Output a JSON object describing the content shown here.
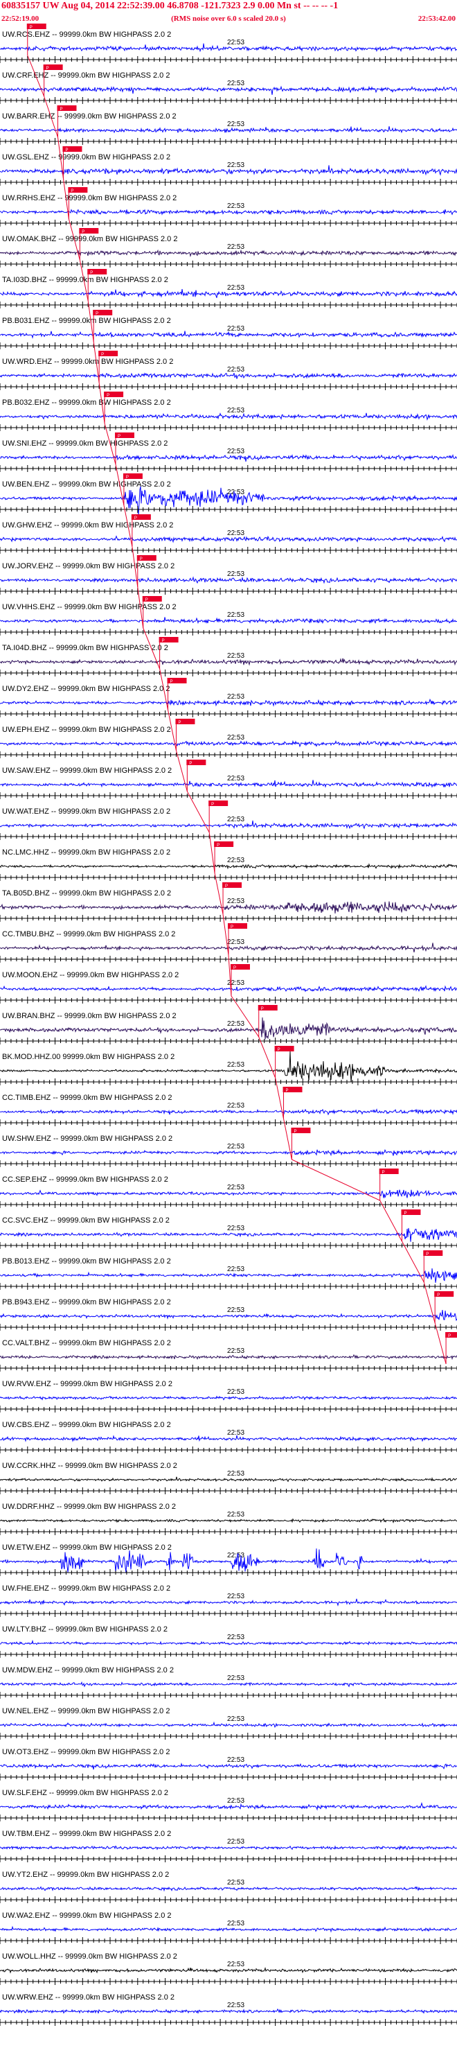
{
  "header": {
    "title": "60835157 UW Aug 04, 2014 22:52:39.00    46.8708 -121.7323  2.9 0.00 Mn st -- -- -- -1",
    "subtitle": "(RMS noise over 6.0 s scaled 20.0 s)",
    "start_time": "22:52:19.00",
    "end_time": "22:53:42.00"
  },
  "chart_data": {
    "type": "line",
    "title": "60835157 UW Aug 04, 2014 22:52:39.00    46.8708 -121.7323  2.9 0.00 Mn st -- -- -- -1",
    "xlabel": "",
    "ylabel": "",
    "x_start": "22:52:19.00",
    "x_end": "22:53:42.00",
    "x_range_s": [
      0,
      83
    ],
    "minute_tick_label": "22:53",
    "minute_tick_s": 41,
    "pick_label": "P",
    "colors": {
      "blue": "#0000ff",
      "black": "#000000",
      "purple": "#2b0d5a",
      "pick": "#e8002a"
    },
    "series": [
      {
        "label": "UW.RCS.EHZ -- 99999.0km BW  HIGHPASS  2.0  2",
        "color": "blue",
        "amp": 0.45,
        "pick_s": 5.0,
        "bursts": []
      },
      {
        "label": "UW.CRF.EHZ -- 99999.0km BW  HIGHPASS  2.0  2",
        "color": "blue",
        "amp": 0.45,
        "pick_s": 8.0,
        "bursts": []
      },
      {
        "label": "UW.BARR.EHZ -- 99999.0km BW  HIGHPASS  2.0  2",
        "color": "blue",
        "amp": 0.4,
        "pick_s": 10.5,
        "bursts": []
      },
      {
        "label": "UW.GSL.EHZ -- 99999.0km BW  HIGHPASS  2.0  2",
        "color": "blue",
        "amp": 0.55,
        "pick_s": 11.5,
        "bursts": []
      },
      {
        "label": "UW.RRHS.EHZ -- 99999.0km BW  HIGHPASS  2.0  2",
        "color": "blue",
        "amp": 0.45,
        "pick_s": 12.5,
        "bursts": []
      },
      {
        "label": "UW.OMAK.BHZ -- 99999.0km BW  HIGHPASS  2.0  2",
        "color": "purple",
        "amp": 0.45,
        "pick_s": 14.5,
        "bursts": []
      },
      {
        "label": "TA.I03D.BHZ -- 99999.0km BW  HIGHPASS  2.0  2",
        "color": "blue",
        "amp": 0.5,
        "pick_s": 16.0,
        "bursts": []
      },
      {
        "label": "PB.B031.EHZ -- 99999.0km BW  HIGHPASS  2.0  2",
        "color": "blue",
        "amp": 0.45,
        "pick_s": 17.0,
        "bursts": []
      },
      {
        "label": "UW.WRD.EHZ -- 99999.0km BW  HIGHPASS  2.0  2",
        "color": "blue",
        "amp": 0.45,
        "pick_s": 18.0,
        "bursts": []
      },
      {
        "label": "PB.B032.EHZ -- 99999.0km BW  HIGHPASS  2.0  2",
        "color": "blue",
        "amp": 0.45,
        "pick_s": 19.0,
        "bursts": []
      },
      {
        "label": "UW.SNI.EHZ -- 99999.0km BW  HIGHPASS  2.0  2",
        "color": "blue",
        "amp": 0.45,
        "pick_s": 21.0,
        "bursts": []
      },
      {
        "label": "UW.BEN.EHZ -- 99999.0km BW  HIGHPASS  2.0  2",
        "color": "blue",
        "amp": 0.45,
        "pick_s": 22.5,
        "bursts": [
          [
            22.5,
            48.0,
            2.2
          ]
        ]
      },
      {
        "label": "UW.GHW.EHZ -- 99999.0km BW  HIGHPASS  2.0  2",
        "color": "blue",
        "amp": 0.45,
        "pick_s": 24.0,
        "bursts": []
      },
      {
        "label": "UW.JORV.EHZ -- 99999.0km BW  HIGHPASS  2.0  2",
        "color": "blue",
        "amp": 0.45,
        "pick_s": 25.0,
        "bursts": []
      },
      {
        "label": "UW.VHHS.EHZ -- 99999.0km BW  HIGHPASS  2.0  2",
        "color": "blue",
        "amp": 0.45,
        "pick_s": 26.0,
        "bursts": []
      },
      {
        "label": "TA.I04D.BHZ -- 99999.0km BW  HIGHPASS  2.0  2",
        "color": "purple",
        "amp": 0.45,
        "pick_s": 29.0,
        "bursts": []
      },
      {
        "label": "UW.DY2.EHZ -- 99999.0km BW  HIGHPASS  2.0  2",
        "color": "blue",
        "amp": 0.45,
        "pick_s": 30.5,
        "bursts": []
      },
      {
        "label": "UW.EPH.EHZ -- 99999.0km BW  HIGHPASS  2.0  2",
        "color": "blue",
        "amp": 0.45,
        "pick_s": 32.0,
        "bursts": []
      },
      {
        "label": "UW.SAW.EHZ -- 99999.0km BW  HIGHPASS  2.0  2",
        "color": "blue",
        "amp": 0.45,
        "pick_s": 34.0,
        "bursts": []
      },
      {
        "label": "UW.WAT.EHZ -- 99999.0km BW  HIGHPASS  2.0  2",
        "color": "blue",
        "amp": 0.45,
        "pick_s": 38.0,
        "bursts": []
      },
      {
        "label": "NC.LMC.HHZ -- 99999.0km BW  HIGHPASS  2.0  2",
        "color": "black",
        "amp": 0.35,
        "pick_s": 39.0,
        "bursts": []
      },
      {
        "label": "TA.B05D.BHZ -- 99999.0km BW  HIGHPASS  2.0  2",
        "color": "purple",
        "amp": 0.55,
        "pick_s": 40.5,
        "bursts": [
          [
            52.0,
            83.0,
            1.4
          ]
        ]
      },
      {
        "label": "CC.TMBU.BHZ -- 99999.0km BW  HIGHPASS  2.0  2",
        "color": "purple",
        "amp": 0.45,
        "pick_s": 41.5,
        "bursts": []
      },
      {
        "label": "UW.MOON.EHZ -- 99999.0km BW  HIGHPASS  2.0  2",
        "color": "blue",
        "amp": 0.45,
        "pick_s": 42.0,
        "bursts": []
      },
      {
        "label": "UW.BRAN.BHZ -- 99999.0km BW  HIGHPASS  2.0  2",
        "color": "purple",
        "amp": 0.6,
        "pick_s": 47.0,
        "bursts": [
          [
            47.5,
            60.0,
            2.4
          ]
        ]
      },
      {
        "label": "BK.MOD.HHZ.00 99999.0km BW  HIGHPASS  2.0  2",
        "color": "black",
        "amp": 0.35,
        "pick_s": 50.0,
        "bursts": [
          [
            51.5,
            70.0,
            2.2
          ]
        ]
      },
      {
        "label": "CC.TIMB.EHZ -- 99999.0km BW  HIGHPASS  2.0  2",
        "color": "blue",
        "amp": 0.45,
        "pick_s": 51.5,
        "bursts": []
      },
      {
        "label": "UW.SHW.EHZ -- 99999.0km BW  HIGHPASS  2.0  2",
        "color": "blue",
        "amp": 0.45,
        "pick_s": 53.0,
        "bursts": []
      },
      {
        "label": "CC.SEP.EHZ -- 99999.0km BW  HIGHPASS  2.0  2",
        "color": "blue",
        "amp": 0.45,
        "pick_s": 69.0,
        "bursts": [
          [
            69.0,
            80.0,
            1.0
          ]
        ]
      },
      {
        "label": "CC.SVC.EHZ -- 99999.0km BW  HIGHPASS  2.0  2",
        "color": "blue",
        "amp": 0.45,
        "pick_s": 73.0,
        "bursts": [
          [
            73.0,
            83.0,
            1.6
          ]
        ]
      },
      {
        "label": "PB.B013.EHZ -- 99999.0km BW  HIGHPASS  2.0  2",
        "color": "blue",
        "amp": 0.45,
        "pick_s": 77.0,
        "bursts": [
          [
            77.0,
            83.0,
            1.6
          ]
        ]
      },
      {
        "label": "PB.B943.EHZ -- 99999.0km BW  HIGHPASS  2.0  2",
        "color": "blue",
        "amp": 0.45,
        "pick_s": 79.0,
        "bursts": [
          [
            79.0,
            83.0,
            1.6
          ]
        ]
      },
      {
        "label": "CC.VALT.BHZ -- 99999.0km BW  HIGHPASS  2.0  2",
        "color": "purple",
        "amp": 0.45,
        "pick_s": 81.0,
        "bursts": []
      },
      {
        "label": "UW.RVW.EHZ -- 99999.0km BW  HIGHPASS  2.0  2",
        "color": "blue",
        "amp": 0.45,
        "pick_s": null,
        "bursts": []
      },
      {
        "label": "UW.CBS.EHZ -- 99999.0km BW  HIGHPASS  2.0  2",
        "color": "blue",
        "amp": 0.5,
        "pick_s": null,
        "bursts": []
      },
      {
        "label": "UW.CCRK.HHZ -- 99999.0km BW  HIGHPASS  2.0  2",
        "color": "black",
        "amp": 0.4,
        "pick_s": null,
        "bursts": []
      },
      {
        "label": "UW.DDRF.HHZ -- 99999.0km BW  HIGHPASS  2.0  2",
        "color": "black",
        "amp": 0.4,
        "pick_s": null,
        "bursts": []
      },
      {
        "label": "UW.ETW.EHZ -- 99999.0km BW  HIGHPASS  2.0  2",
        "color": "blue",
        "amp": 0.45,
        "pick_s": null,
        "bursts": [
          [
            11.0,
            15.0,
            3.0
          ],
          [
            21.0,
            27.0,
            3.0
          ],
          [
            30.0,
            31.5,
            3.0
          ],
          [
            33.0,
            35.0,
            3.0
          ],
          [
            42.0,
            47.0,
            3.0
          ],
          [
            57.0,
            59.0,
            3.0
          ],
          [
            61.0,
            63.0,
            3.0
          ],
          [
            65.0,
            66.0,
            3.0
          ]
        ]
      },
      {
        "label": "UW.FHE.EHZ -- 99999.0km BW  HIGHPASS  2.0  2",
        "color": "blue",
        "amp": 0.45,
        "pick_s": null,
        "bursts": []
      },
      {
        "label": "UW.LTY.BHZ -- 99999.0km BW  HIGHPASS  2.0  2",
        "color": "blue",
        "amp": 0.4,
        "pick_s": null,
        "bursts": []
      },
      {
        "label": "UW.MDW.EHZ -- 99999.0km BW  HIGHPASS  2.0  2",
        "color": "blue",
        "amp": 0.45,
        "pick_s": null,
        "bursts": []
      },
      {
        "label": "UW.NEL.EHZ -- 99999.0km BW  HIGHPASS  2.0  2",
        "color": "blue",
        "amp": 0.45,
        "pick_s": null,
        "bursts": []
      },
      {
        "label": "UW.OT3.EHZ -- 99999.0km BW  HIGHPASS  2.0  2",
        "color": "blue",
        "amp": 0.55,
        "pick_s": null,
        "bursts": []
      },
      {
        "label": "UW.SLF.EHZ -- 99999.0km BW  HIGHPASS  2.0  2",
        "color": "blue",
        "amp": 0.55,
        "pick_s": null,
        "bursts": []
      },
      {
        "label": "UW.TBM.EHZ -- 99999.0km BW  HIGHPASS  2.0  2",
        "color": "blue",
        "amp": 0.45,
        "pick_s": null,
        "bursts": []
      },
      {
        "label": "UW.YT2.EHZ -- 99999.0km BW  HIGHPASS  2.0  2",
        "color": "blue",
        "amp": 0.45,
        "pick_s": null,
        "bursts": []
      },
      {
        "label": "UW.WA2.EHZ -- 99999.0km BW  HIGHPASS  2.0  2",
        "color": "blue",
        "amp": 0.45,
        "pick_s": null,
        "bursts": []
      },
      {
        "label": "UW.WOLL.HHZ -- 99999.0km BW  HIGHPASS  2.0  2",
        "color": "black",
        "amp": 0.5,
        "pick_s": null,
        "bursts": []
      },
      {
        "label": "UW.WRW.EHZ -- 99999.0km BW  HIGHPASS  2.0  2",
        "color": "blue",
        "amp": 0.45,
        "pick_s": null,
        "bursts": []
      }
    ]
  }
}
